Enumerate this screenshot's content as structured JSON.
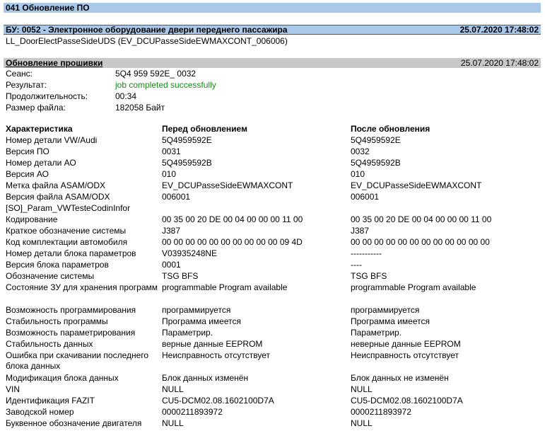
{
  "title_bar": {
    "text": "041 Обновление ПО"
  },
  "ecu_bar": {
    "text": "БУ: 0052 - Электронное оборудование двери переднего пассажира",
    "timestamp": "25.07.2020 17:48:02"
  },
  "ecu_subtitle": "LL_DoorElectPasseSideUDS (EV_DCUPasseSideEWMAXCONT_006006)",
  "firmware_bar": {
    "text": "Обновление прошивки",
    "timestamp": "25.07.2020 17:48:02"
  },
  "session": [
    {
      "label": "Сеанс:",
      "value": "5Q4 959 592E_ 0032"
    },
    {
      "label": "Результат:",
      "value": "job completed successfully"
    },
    {
      "label": "Продолжительность:",
      "value": "00:34"
    },
    {
      "label": "Размер файла:",
      "value": "182058 Байт"
    }
  ],
  "table_header": {
    "col1": "Характеристика",
    "col2": "Перед обновлением",
    "col3": "После обновления"
  },
  "rows": [
    {
      "label": "Номер детали VW/Audi",
      "before": "5Q4959592E",
      "after": "5Q4959592E"
    },
    {
      "label": "Версия ПО",
      "before": "0031",
      "after": "0032"
    },
    {
      "label": "Номер детали АО",
      "before": "5Q4959592B",
      "after": "5Q4959592B"
    },
    {
      "label": "Версия АО",
      "before": "010",
      "after": "010"
    },
    {
      "label": "Метка файла ASAM/ODX",
      "before": "EV_DCUPasseSideEWMAXCONT",
      "after": "EV_DCUPasseSideEWMAXCONT"
    },
    {
      "label": "Версия файла ASAM/ODX",
      "before": "006001",
      "after": "006001"
    },
    {
      "label": "[SO]_Param_VWTesteCodinInfor",
      "before": "",
      "after": ""
    },
    {
      "label": "Кодирование",
      "before": "00 35 00 20 DE 00 04 00 00 00 11 00",
      "after": "00 35 00 20 DE 00 04 00 00 00 11 00"
    },
    {
      "label": "Краткое обозначение системы",
      "before": "J387",
      "after": "J387"
    },
    {
      "label": "Код комплектации автомобиля",
      "before": "00 00 00 00 00 00 00 00 00 00 09 4D",
      "after": "00 00 00 00 00 00 00 00 00 00 00 00"
    },
    {
      "label": "Номер детали блока параметров",
      "before": "V03935248NE",
      "after": "-----------"
    },
    {
      "label": "Версия блока параметров",
      "before": "0001",
      "after": "----"
    },
    {
      "label": "Обозначение системы",
      "before": "TSG BFS",
      "after": "TSG BFS"
    },
    {
      "label": "Состояние ЗУ для хранения программ",
      "before": "programmable Program available",
      "after": "programmable Program available"
    },
    {
      "label": "Возможность программирования",
      "before": "программируется",
      "after": "программируется"
    },
    {
      "label": "Стабильность программы",
      "before": "Программа имеется",
      "after": "Программа имеется"
    },
    {
      "label": "Возможность параметрирования",
      "before": "Параметрир.",
      "after": "Параметрир."
    },
    {
      "label": "Стабильность данных",
      "before": "верные данные EEPROM",
      "after": "неверные данные EEPROM"
    },
    {
      "label": "Ошибка при скачивании последнего блока данных",
      "before": "Неисправность отсутствует",
      "after": "Неисправность отсутствует"
    },
    {
      "label": "Модификация блока данных",
      "before": "Блок данных изменён",
      "after": "Блок данных не изменён"
    },
    {
      "label": "VIN",
      "before": "NULL",
      "after": "NULL"
    },
    {
      "label": "Идентификация FAZIT",
      "before": "CU5-DCM02.08.1602100D7A",
      "after": "CU5-DCM02.08.1602100D7A"
    },
    {
      "label": "Заводской номер",
      "before": "0000211893972",
      "after": "0000211893972"
    },
    {
      "label": "Буквенное обозначение двигателя",
      "before": "NULL",
      "after": "NULL"
    }
  ]
}
